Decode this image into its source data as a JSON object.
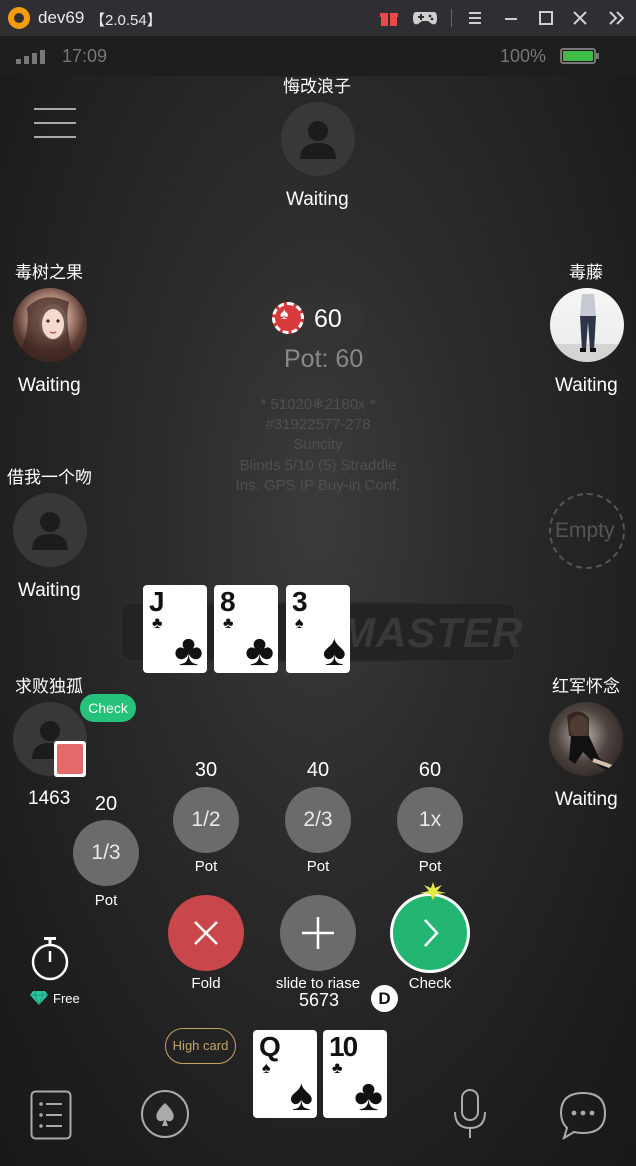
{
  "titlebar": {
    "app_name": "dev69",
    "version": "【2.0.54】",
    "icons": [
      "gift-icon",
      "gamepad-icon",
      "menu-icon",
      "minimize-icon",
      "maximize-icon",
      "close-icon",
      "expand-icon"
    ]
  },
  "status_bar": {
    "time": "17:09",
    "battery_pct": "100%",
    "battery_level": 1.0
  },
  "table": {
    "pot_chip_amount": "60",
    "pot_label": "Pot: 60",
    "info_lines": [
      "* 51020❄2180x *",
      "#31922577-278",
      "Suncity",
      "Blinds 5/10 (5) Straddle",
      "Ins. GPS IP Buy-in Conf."
    ],
    "logo_text": "MASTER"
  },
  "seats": {
    "top": {
      "name": "悔改浪子",
      "status": "Waiting"
    },
    "left_upper": {
      "name": "毒树之果",
      "status": "Waiting"
    },
    "right_upper": {
      "name": "毒藤",
      "status": "Waiting"
    },
    "left_middle": {
      "name": "借我一个吻",
      "status": "Waiting"
    },
    "right_middle": {
      "label": "Empty"
    },
    "left_lower": {
      "name": "求败独孤",
      "action": "Check",
      "stack": "1463"
    },
    "right_lower": {
      "name": "红军怀念",
      "status": "Waiting"
    }
  },
  "board_cards": [
    {
      "rank": "J",
      "suit": "♣"
    },
    {
      "rank": "8",
      "suit": "♣"
    },
    {
      "rank": "3",
      "suit": "♠"
    }
  ],
  "bet_presets": [
    {
      "amount": "20",
      "label": "1/3",
      "sub": "Pot"
    },
    {
      "amount": "30",
      "label": "1/2",
      "sub": "Pot"
    },
    {
      "amount": "40",
      "label": "2/3",
      "sub": "Pot"
    },
    {
      "amount": "60",
      "label": "1x",
      "sub": "Pot"
    }
  ],
  "actions": {
    "fold": "Fold",
    "raise": "slide to riase",
    "check": "Check",
    "raise_amount": "5673",
    "dealer": "D"
  },
  "timer": {
    "free_label": "Free"
  },
  "hand": {
    "rank_label": "High card",
    "cards": [
      {
        "rank": "Q",
        "suit": "♠"
      },
      {
        "rank": "10",
        "suit": "♣"
      }
    ]
  },
  "bottom_bar": {
    "icons": [
      "history-list-icon",
      "spade-icon",
      "microphone-icon",
      "chat-icon"
    ]
  },
  "colors": {
    "fold": "#c9474b",
    "check": "#23b673",
    "preset": "#6b6b6b",
    "high_card_border": "#c8a26a"
  }
}
